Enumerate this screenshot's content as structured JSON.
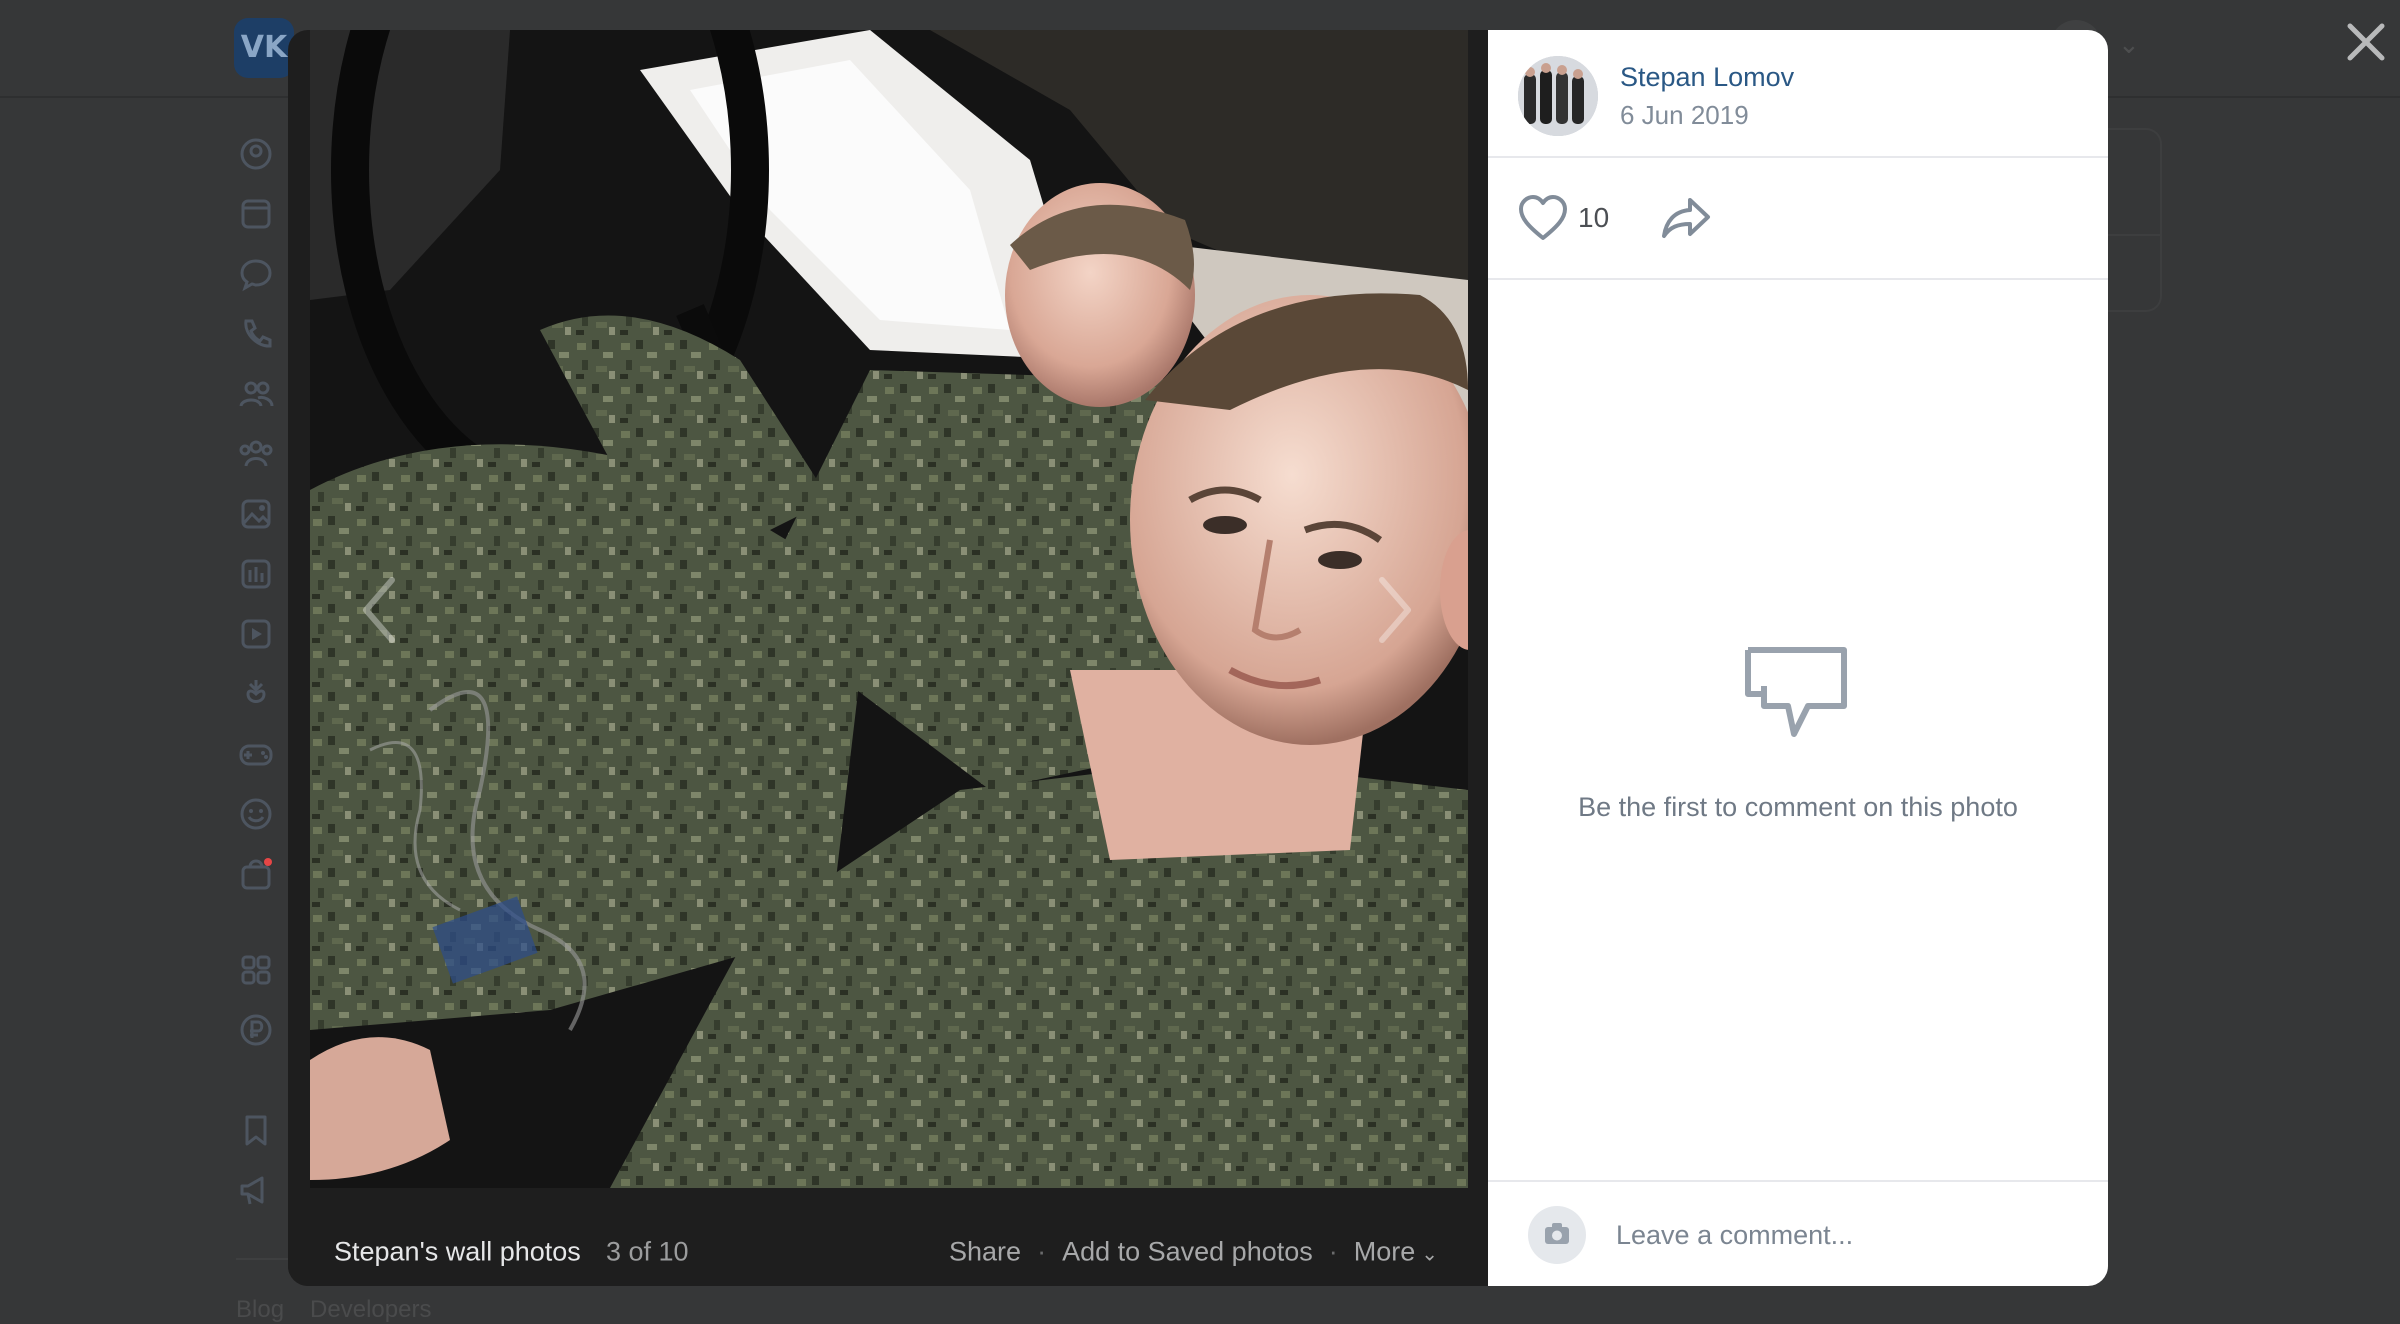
{
  "app": {
    "logo_text": "VK"
  },
  "footer": {
    "links": [
      "Blog",
      "Developers"
    ]
  },
  "sidebar_icons": [
    "profile-icon",
    "news-icon",
    "messenger-icon",
    "calls-icon",
    "friends-icon",
    "communities-icon",
    "photos-icon",
    "music-icon",
    "videos-icon",
    "clips-icon",
    "games-icon",
    "stickers-icon",
    "market-icon",
    "services-icon",
    "vk-pay-icon",
    "bookmarks-icon",
    "ads-icon"
  ],
  "viewer": {
    "album_title": "Stepan's wall photos",
    "counter": "3 of 10",
    "actions": {
      "share": "Share",
      "save": "Add to Saved photos",
      "more": "More"
    },
    "author": {
      "name": "Stepan Lomov",
      "date": "6 Jun 2019"
    },
    "likes": "10",
    "empty_comments": "Be the first to comment on this photo",
    "comment_placeholder": "Leave a comment..."
  },
  "colors": {
    "link": "#2a5885",
    "muted": "#818c99",
    "overlay": "#363738",
    "viewer_bg": "#1e1e1e"
  }
}
